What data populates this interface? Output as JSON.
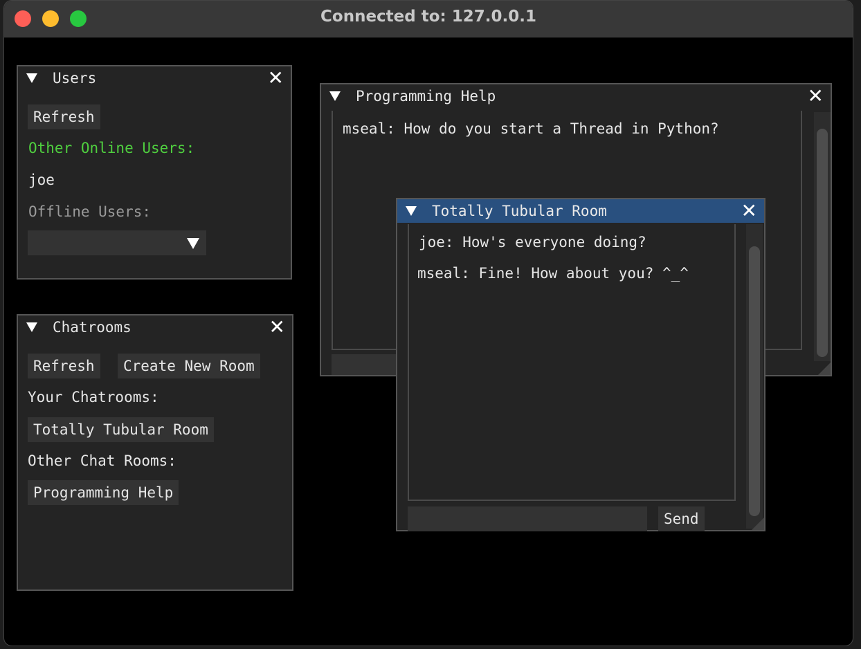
{
  "window": {
    "title": "Connected to: 127.0.0.1"
  },
  "users_panel": {
    "title": "Users",
    "refresh_label": "Refresh",
    "online_heading": "Other Online Users:",
    "online_users": [
      "joe"
    ],
    "offline_heading": "Offline Users:",
    "offline_selected": ""
  },
  "chatrooms_panel": {
    "title": "Chatrooms",
    "refresh_label": "Refresh",
    "create_label": "Create New Room",
    "your_heading": "Your Chatrooms:",
    "your_rooms": [
      "Totally Tubular Room"
    ],
    "other_heading": "Other Chat Rooms:",
    "other_rooms": [
      "Programming Help"
    ]
  },
  "programming_help": {
    "title": "Programming Help",
    "messages": [
      "mseal: How do you start a Thread in Python?"
    ]
  },
  "tubular_room": {
    "title": "Totally Tubular Room",
    "messages": [
      "joe: How's everyone doing?",
      "mseal: Fine! How about you? ^_^"
    ],
    "input_value": "",
    "send_label": "Send"
  },
  "icons": {
    "collapse": "triangle-down-icon",
    "close": "close-icon",
    "combo": "chevron-down-icon"
  }
}
